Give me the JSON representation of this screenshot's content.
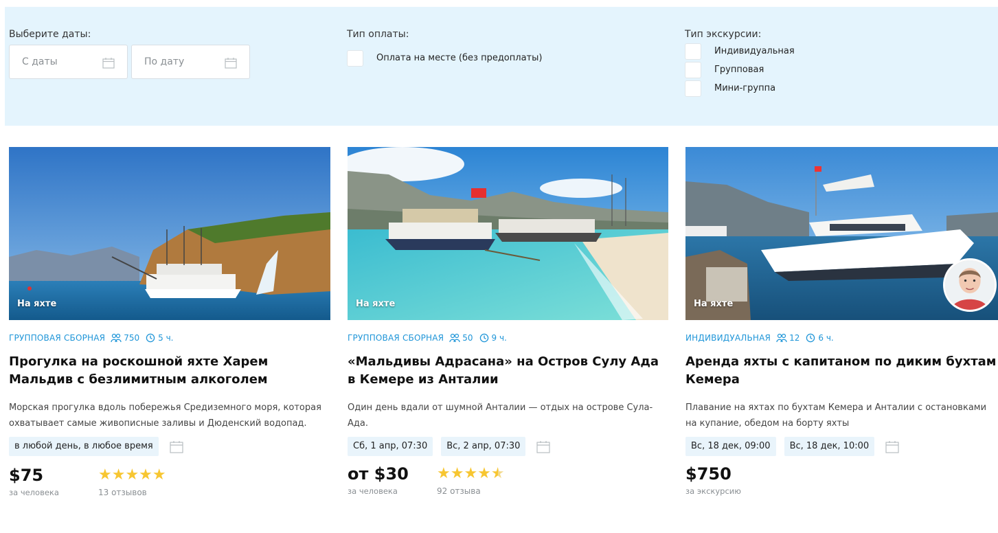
{
  "filters": {
    "dates_label": "Выберите даты:",
    "date_from_placeholder": "С даты",
    "date_to_placeholder": "По дату",
    "payment_label": "Тип оплаты:",
    "payment_options": [
      "Оплата на месте (без предоплаты)"
    ],
    "excursion_label": "Тип экскурсии:",
    "excursion_options": [
      "Индивидуальная",
      "Групповая",
      "Мини-группа"
    ]
  },
  "cards": [
    {
      "badge": "На яхте",
      "kind": "Групповая сборная",
      "people": "750",
      "duration": "5 ч.",
      "title": "Прогулка на роскошной яхте Харем Мальдив с безлимитным алкоголем",
      "description": "Морская прогулка вдоль побережья Средиземного моря, которая охватывает самые живописные заливы и Дюденский водопад.",
      "slots": [
        "в любой день, в любое время"
      ],
      "price": "$75",
      "price_unit": "за человека",
      "stars": "★★★★★",
      "rating": 5,
      "reviews": "13 отзывов"
    },
    {
      "badge": "На яхте",
      "kind": "Групповая сборная",
      "people": "50",
      "duration": "9 ч.",
      "title": "«Мальдивы Адрасана» на Остров Сулу Ада в Кемере из Анталии",
      "description": "Один день вдали от шумной Анталии — отдых на острове Сула-Ада.",
      "slots": [
        "Сб, 1 апр, 07:30",
        "Вс, 2 апр, 07:30"
      ],
      "price": "от $30",
      "price_unit": "за человека",
      "stars": "★★★★★",
      "rating": 4.5,
      "reviews": "92 отзыва"
    },
    {
      "badge": "На яхте",
      "kind": "Индивидуальная",
      "people": "12",
      "duration": "6 ч.",
      "title": "Аренда яхты с капитаном по диким бухтам Кемера",
      "description": "Плавание на яхтах по бухтам Кемера и Анталии с остановками на купание, обедом на борту яхты",
      "slots": [
        "Вс, 18 дек, 09:00",
        "Вс, 18 дек, 10:00"
      ],
      "price": "$750",
      "price_unit": "за экскурсию"
    }
  ],
  "colors": {
    "filter_bg": "#e4f4fd",
    "accent": "#1e95d8",
    "star": "#f7c631",
    "slot_bg": "#e9f4fb"
  }
}
